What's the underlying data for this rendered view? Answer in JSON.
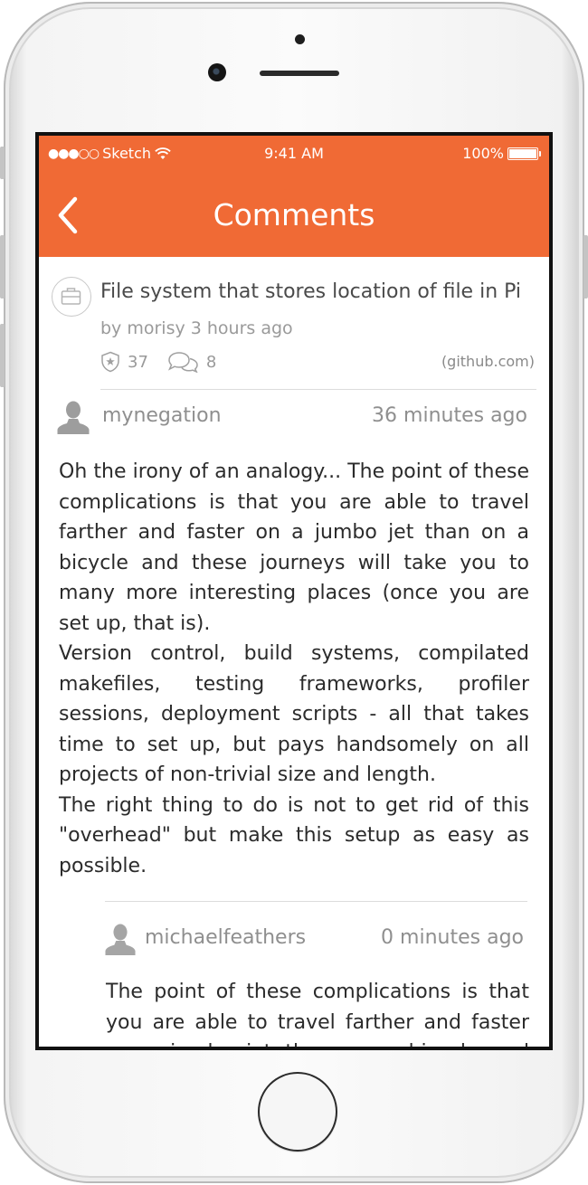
{
  "status_bar": {
    "carrier": "Sketch",
    "time": "9:41 AM",
    "battery": "100%"
  },
  "nav": {
    "title": "Comments",
    "back_icon": "chevron-left-icon"
  },
  "post": {
    "icon": "briefcase-icon",
    "title": "File system that stores location of file in Pi",
    "meta": "by morisy 3 hours ago",
    "points": "37",
    "comments": "8",
    "domain": "(github.com)"
  },
  "comments": [
    {
      "user": "mynegation",
      "time": "36 minutes ago",
      "paragraphs": [
        "Oh the irony of an analogy... The point of these complications is that you are able to travel farther and faster on a jumbo jet than on a bicycle and these journeys will take you to many more interesting places (once you are set up, that is).",
        "Version control, build systems, compilated makefiles, testing frameworks, profiler sessions, deployment scripts - all that takes time to set up, but pays handsomely on all projects of non-trivial size and length.",
        "The right thing to do is not to get rid of this \"overhead\" but make this setup as easy as possible."
      ]
    },
    {
      "user": "michaelfeathers",
      "time": "0 minutes ago",
      "paragraphs": [
        "The point of these complications is that you are able to travel farther and faster on a jumbo jet than on a bicycle and these journeys"
      ]
    }
  ],
  "colors": {
    "accent": "#f06a35",
    "text": "#2b2b2b",
    "muted": "#8f8f8f"
  }
}
